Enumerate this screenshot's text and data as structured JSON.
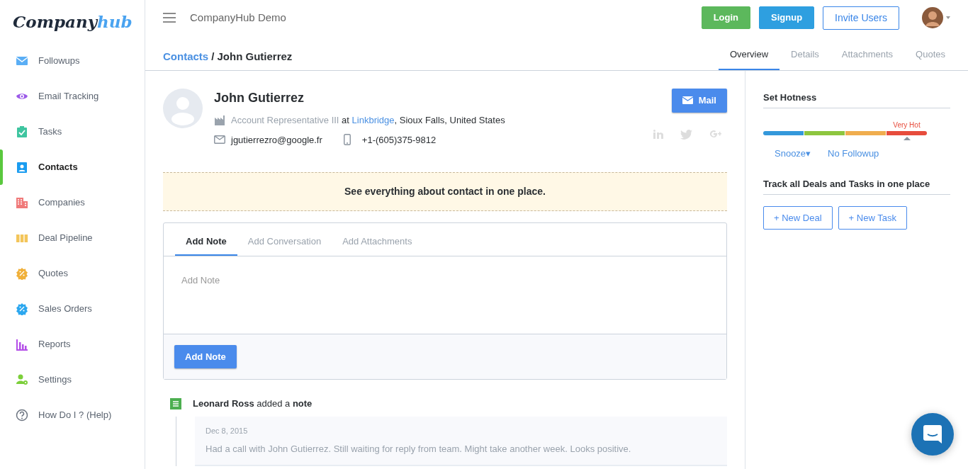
{
  "logo": {
    "text": "Company",
    "accent": "hub"
  },
  "sidebar": {
    "items": [
      {
        "label": "Followups",
        "kind": "mail",
        "selected": false
      },
      {
        "label": "Email Tracking",
        "kind": "eye",
        "selected": false
      },
      {
        "label": "Tasks",
        "kind": "clipboard",
        "selected": false
      },
      {
        "label": "Contacts",
        "kind": "contact",
        "selected": true
      },
      {
        "label": "Companies",
        "kind": "building",
        "selected": false
      },
      {
        "label": "Deal Pipeline",
        "kind": "pipeline",
        "selected": false
      },
      {
        "label": "Quotes",
        "kind": "quote",
        "selected": false
      },
      {
        "label": "Sales Orders",
        "kind": "order",
        "selected": false
      },
      {
        "label": "Reports",
        "kind": "chart",
        "selected": false
      },
      {
        "label": "Settings",
        "kind": "usergear",
        "selected": false
      },
      {
        "label": "How Do I ? (Help)",
        "kind": "help",
        "selected": false
      }
    ]
  },
  "header": {
    "title": "CompanyHub Demo",
    "buttons": [
      {
        "label": "Login",
        "kind": "success"
      },
      {
        "label": "Signup",
        "kind": "info"
      },
      {
        "label": "Invite Users",
        "kind": "outline"
      }
    ]
  },
  "breadcrumb": {
    "parent": "Contacts",
    "current": "/ John Gutierrez"
  },
  "tabs": [
    {
      "label": "Overview",
      "selected": true
    },
    {
      "label": "Details",
      "selected": false
    },
    {
      "label": "Attachments",
      "selected": false
    },
    {
      "label": "Quotes",
      "selected": false
    }
  ],
  "contact": {
    "name": "John Gutierrez",
    "role": "Account Representative III",
    "at": "at",
    "company": "Linkbridge",
    "location": ", Sioux Falls, United States",
    "email": "jgutierrezro@google.fr",
    "phone": "+1-(605)375-9812",
    "mail_button": "Mail"
  },
  "banner": "See everything about contact in one place.",
  "composer": {
    "tabs": [
      {
        "label": "Add Note",
        "selected": true
      },
      {
        "label": "Add Conversation",
        "selected": false
      },
      {
        "label": "Add Attachments",
        "selected": false
      }
    ],
    "placeholder": "Add Note",
    "button": "Add Note"
  },
  "timeline": [
    {
      "headline": "**Leonard Ross** added a **note**",
      "date": "Dec 8, 2015",
      "text": "Had a call with John Gutierrez. Still waiting for reply from team. Might take another week. Looks positive."
    }
  ],
  "hotness": {
    "title": "Set Hotness",
    "segments": [
      {
        "color": "#3498db",
        "selected": false
      },
      {
        "color": "#8dc63f",
        "selected": false
      },
      {
        "color": "#f0ad4e",
        "selected": false
      },
      {
        "color": "#e74c3c",
        "selected": true,
        "label": "Very Hot"
      }
    ],
    "snooze": "Snooze▾",
    "followup": "No Followup"
  },
  "deals": {
    "title": "Track all Deals and Tasks in one place",
    "buttons": [
      "+ New Deal",
      "+ New Task"
    ]
  }
}
